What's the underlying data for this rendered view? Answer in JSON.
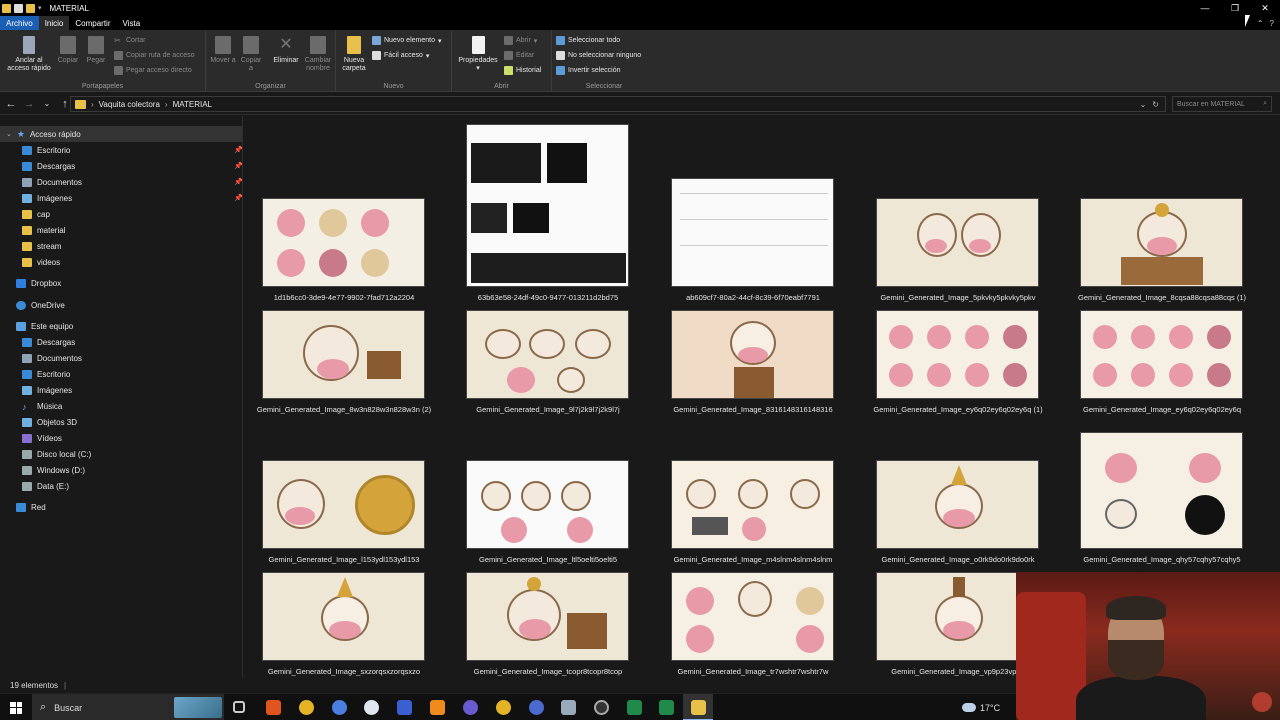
{
  "window": {
    "title": "MATERIAL",
    "minimize": "—",
    "restore": "❐",
    "close": "✕"
  },
  "tabs": [
    "Archivo",
    "Inicio",
    "Compartir",
    "Vista"
  ],
  "ribbon": {
    "portapapeles": {
      "label": "Portapapeles",
      "anclar": "Anclar al acceso rápido",
      "copiar": "Copiar",
      "pegar": "Pegar",
      "cortar": "Cortar",
      "copiar_ruta": "Copiar ruta de acceso",
      "pegar_acceso": "Pegar acceso directo"
    },
    "organizar": {
      "label": "Organizar",
      "mover": "Mover a",
      "copiar": "Copiar a",
      "eliminar": "Eliminar",
      "cambiar": "Cambiar nombre"
    },
    "nuevo": {
      "label": "Nuevo",
      "nueva_carpeta": "Nueva carpeta",
      "nuevo_elemento": "Nuevo elemento",
      "facil_acceso": "Fácil acceso"
    },
    "abrir": {
      "label": "Abrir",
      "propiedades": "Propiedades",
      "abrir": "Abrir",
      "editar": "Editar",
      "historial": "Historial"
    },
    "seleccionar": {
      "label": "Seleccionar",
      "todo": "Seleccionar todo",
      "ninguno": "No seleccionar ninguno",
      "invertir": "Invertir selección"
    }
  },
  "address": {
    "crumbs": [
      "Vaquita colectora",
      "MATERIAL"
    ],
    "search_placeholder": "Buscar en MATERIAL"
  },
  "nav": {
    "quick_access": "Acceso rápido",
    "quick_items": [
      "Escritorio",
      "Descargas",
      "Documentos",
      "Imágenes",
      "cap",
      "material",
      "stream",
      "videos"
    ],
    "dropbox": "Dropbox",
    "onedrive": "OneDrive",
    "este_equipo": "Este equipo",
    "pc_items": [
      "Descargas",
      "Documentos",
      "Escritorio",
      "Imágenes",
      "Música",
      "Objetos 3D",
      "Vídeos",
      "Disco local (C:)",
      "Windows (D:)",
      "Data (E:)"
    ],
    "red": "Red"
  },
  "files": [
    "1d1b6cc0-3de9-4e77-9902-7fad712a2204",
    "63b63e58-24df-49c0-9477-013211d2bd75",
    "ab609cf7-80a2-44cf-8c39-6f70eabf7791",
    "Gemini_Generated_Image_5pkvky5pkvky5pkv",
    "Gemini_Generated_Image_8cqsa88cqsa88cqs (1)",
    "Gemini_Generated_Image_8w3n828w3n828w3n (2)",
    "Gemini_Generated_Image_9l7j2k9l7j2k9l7j",
    "Gemini_Generated_Image_8316148316148316",
    "Gemini_Generated_Image_ey6q02ey6q02ey6q (1)",
    "Gemini_Generated_Image_ey6q02ey6q02ey6q",
    "Gemini_Generated_Image_l153ydl153ydl153",
    "Gemini_Generated_Image_ltl5oelti5oelti5",
    "Gemini_Generated_Image_m4slnm4slnm4slnm",
    "Gemini_Generated_Image_o0rk9do0rk9do0rk",
    "Gemini_Generated_Image_qhy57cqhy57cqhy5",
    "Gemini_Generated_Image_sxzorqsxzorqsxzo",
    "Gemini_Generated_Image_tcopr8tcopr8tcop",
    "Gemini_Generated_Image_tr7wshtr7wshtr7w",
    "Gemini_Generated_Image_vp9p23vp9p"
  ],
  "status": {
    "count": "19 elementos"
  },
  "taskbar": {
    "search": "Buscar",
    "weather": "17°C"
  },
  "colors": {
    "accent": "#1a5fb4",
    "folder": "#e9c14a",
    "thumb_bg": "#efe7d6",
    "cow_pink": "#e89aa8",
    "gold": "#d4a43a"
  }
}
